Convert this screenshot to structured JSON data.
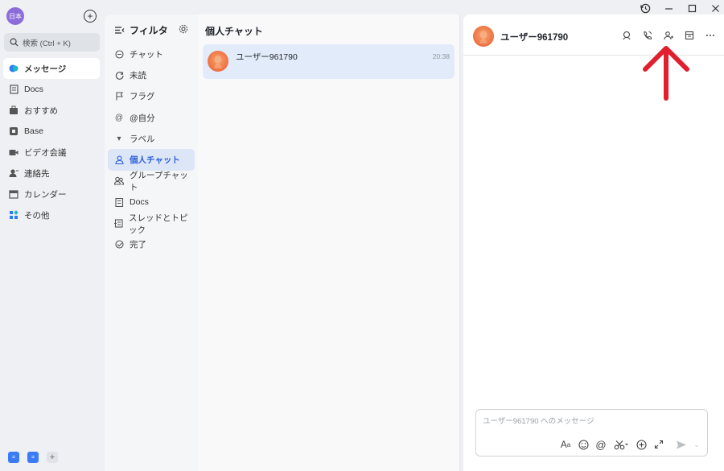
{
  "app": {
    "avatar_text": "日本",
    "search_placeholder": "検索 (Ctrl + K)"
  },
  "nav": {
    "items": [
      {
        "label": "メッセージ",
        "icon": "message-bubble-icon",
        "active": true
      },
      {
        "label": "Docs",
        "icon": "docs-icon"
      },
      {
        "label": "おすすめ",
        "icon": "recommend-icon"
      },
      {
        "label": "Base",
        "icon": "base-icon"
      },
      {
        "label": "ビデオ会議",
        "icon": "video-icon"
      },
      {
        "label": "連絡先",
        "icon": "contacts-icon"
      },
      {
        "label": "カレンダー",
        "icon": "calendar-icon"
      },
      {
        "label": "その他",
        "icon": "apps-icon"
      }
    ]
  },
  "filter": {
    "title": "フィルタ",
    "items": [
      {
        "label": "チャット",
        "icon": "chat-icon"
      },
      {
        "label": "未読",
        "icon": "unread-icon"
      },
      {
        "label": "フラグ",
        "icon": "flag-icon"
      },
      {
        "label": "@自分",
        "icon": "at-icon"
      },
      {
        "label": "ラベル",
        "icon": "triangle-down-icon"
      },
      {
        "label": "個人チャット",
        "icon": "person-icon",
        "active": true
      },
      {
        "label": "グループチャット",
        "icon": "group-icon"
      },
      {
        "label": "Docs",
        "icon": "docs-icon"
      },
      {
        "label": "スレッドとトピック",
        "icon": "thread-icon"
      },
      {
        "label": "完了",
        "icon": "check-circle-icon"
      }
    ]
  },
  "chatlist": {
    "title": "個人チャット",
    "chats": [
      {
        "name": "ユーザー961790",
        "time": "20:38"
      }
    ]
  },
  "conversation": {
    "name": "ユーザー961790",
    "composer_placeholder": "ユーザー961790 へのメッセージ"
  },
  "colors": {
    "accent": "#2b5fd9",
    "annotation_arrow": "#e0202e"
  }
}
